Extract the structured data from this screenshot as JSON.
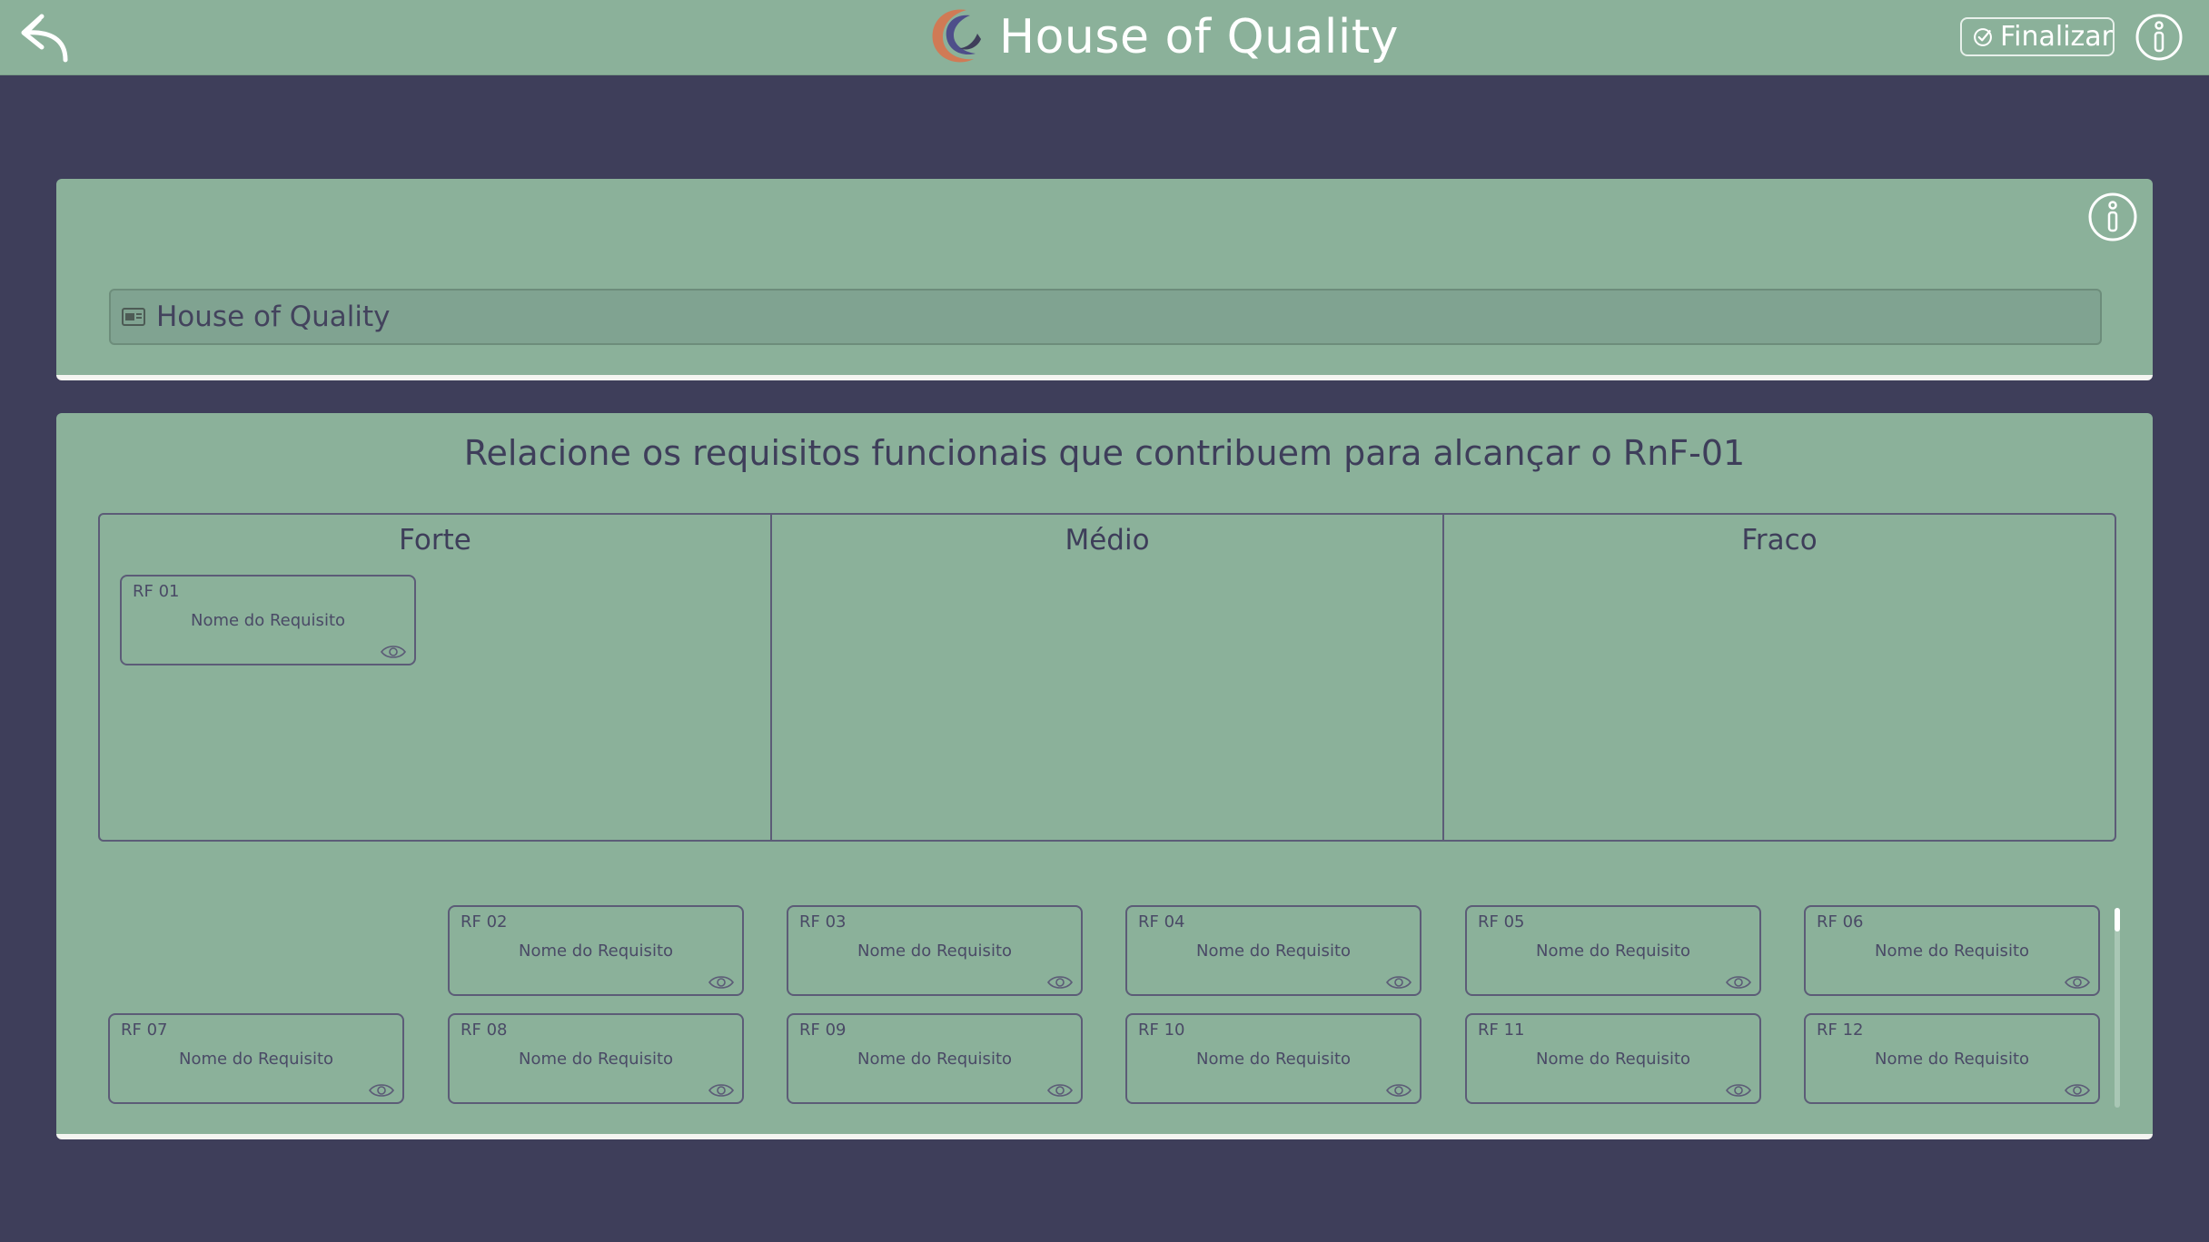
{
  "header": {
    "title": "House of Quality",
    "finalize_label": "Finalizar",
    "back_icon": "back-arrow-icon",
    "info_icon": "info-icon"
  },
  "project": {
    "name_value": "House of Quality",
    "field_icon": "id-card-icon"
  },
  "matrix": {
    "instruction": "Relacione os requisitos funcionais que contribuem para alcançar o RnF-01",
    "columns": [
      {
        "label": "Forte"
      },
      {
        "label": "Médio"
      },
      {
        "label": "Fraco"
      }
    ],
    "placed": [
      {
        "id": "RF 01",
        "name": "Nome do Requisito",
        "column": "Forte"
      }
    ]
  },
  "pool": {
    "cards": [
      {
        "id": "RF 02",
        "name": "Nome do Requisito"
      },
      {
        "id": "RF 03",
        "name": "Nome do Requisito"
      },
      {
        "id": "RF 04",
        "name": "Nome do Requisito"
      },
      {
        "id": "RF 05",
        "name": "Nome do Requisito"
      },
      {
        "id": "RF 06",
        "name": "Nome do Requisito"
      },
      {
        "id": "RF 07",
        "name": "Nome do Requisito"
      },
      {
        "id": "RF 08",
        "name": "Nome do Requisito"
      },
      {
        "id": "RF 09",
        "name": "Nome do Requisito"
      },
      {
        "id": "RF 10",
        "name": "Nome do Requisito"
      },
      {
        "id": "RF 11",
        "name": "Nome do Requisito"
      },
      {
        "id": "RF 12",
        "name": "Nome do Requisito"
      }
    ]
  },
  "colors": {
    "background": "#3e3e5a",
    "panel": "#8bb19a",
    "accent_text": "#3e3e5a"
  }
}
